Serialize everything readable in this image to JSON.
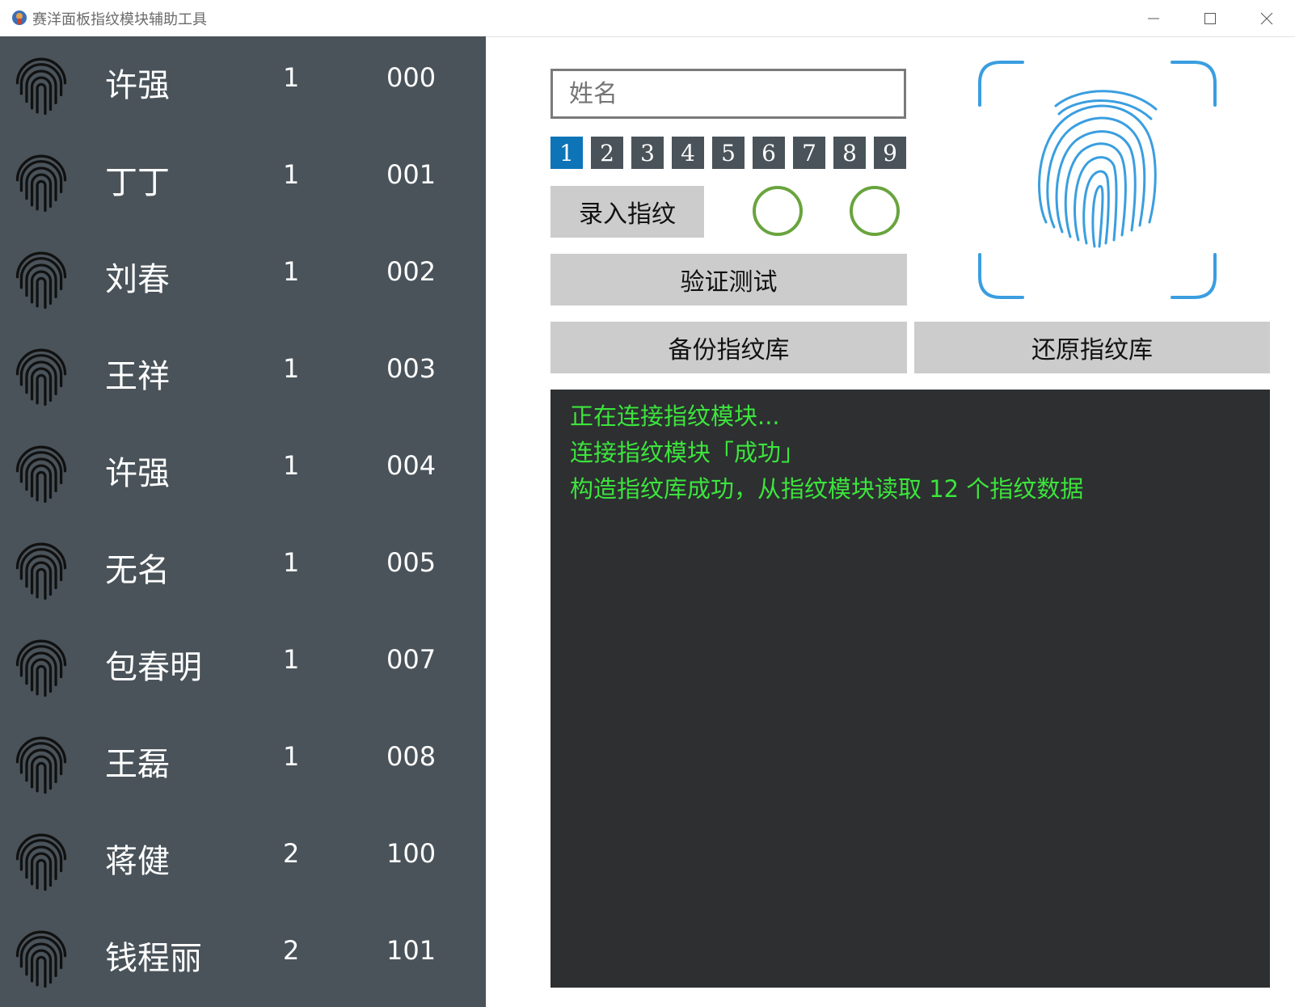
{
  "window": {
    "title": "赛洋面板指纹模块辅助工具",
    "icon": "app-icon",
    "controls": [
      "minimize-icon",
      "maximize-icon",
      "close-icon"
    ]
  },
  "users": [
    {
      "name": "许强",
      "count": "1",
      "id": "000"
    },
    {
      "name": "丁丁",
      "count": "1",
      "id": "001"
    },
    {
      "name": "刘春",
      "count": "1",
      "id": "002"
    },
    {
      "name": "王祥",
      "count": "1",
      "id": "003"
    },
    {
      "name": "许强",
      "count": "1",
      "id": "004"
    },
    {
      "name": "无名",
      "count": "1",
      "id": "005"
    },
    {
      "name": "包春明",
      "count": "1",
      "id": "007"
    },
    {
      "name": "王磊",
      "count": "1",
      "id": "008"
    },
    {
      "name": "蒋健",
      "count": "2",
      "id": "100"
    },
    {
      "name": "钱程丽",
      "count": "2",
      "id": "101"
    }
  ],
  "form": {
    "name_placeholder": "姓名",
    "finger_tabs": [
      "1",
      "2",
      "3",
      "4",
      "5",
      "6",
      "7",
      "8",
      "9"
    ],
    "active_finger": "1",
    "enroll_label": "录入指纹",
    "verify_label": "验证测试",
    "backup_label": "备份指纹库",
    "restore_label": "还原指纹库"
  },
  "log": {
    "lines": [
      "正在连接指纹模块...",
      "连接指纹模块「成功」",
      "构造指纹库成功，从指纹模块读取 12 个指纹数据"
    ]
  },
  "colors": {
    "sidebar_bg": "#4a535a",
    "accent": "#0d74b8",
    "scanner_blue": "#3a9ee0",
    "status_green": "#69a43d",
    "log_bg": "#2d2f31",
    "log_text": "#3ce43c",
    "button_bg": "#cccccc"
  }
}
